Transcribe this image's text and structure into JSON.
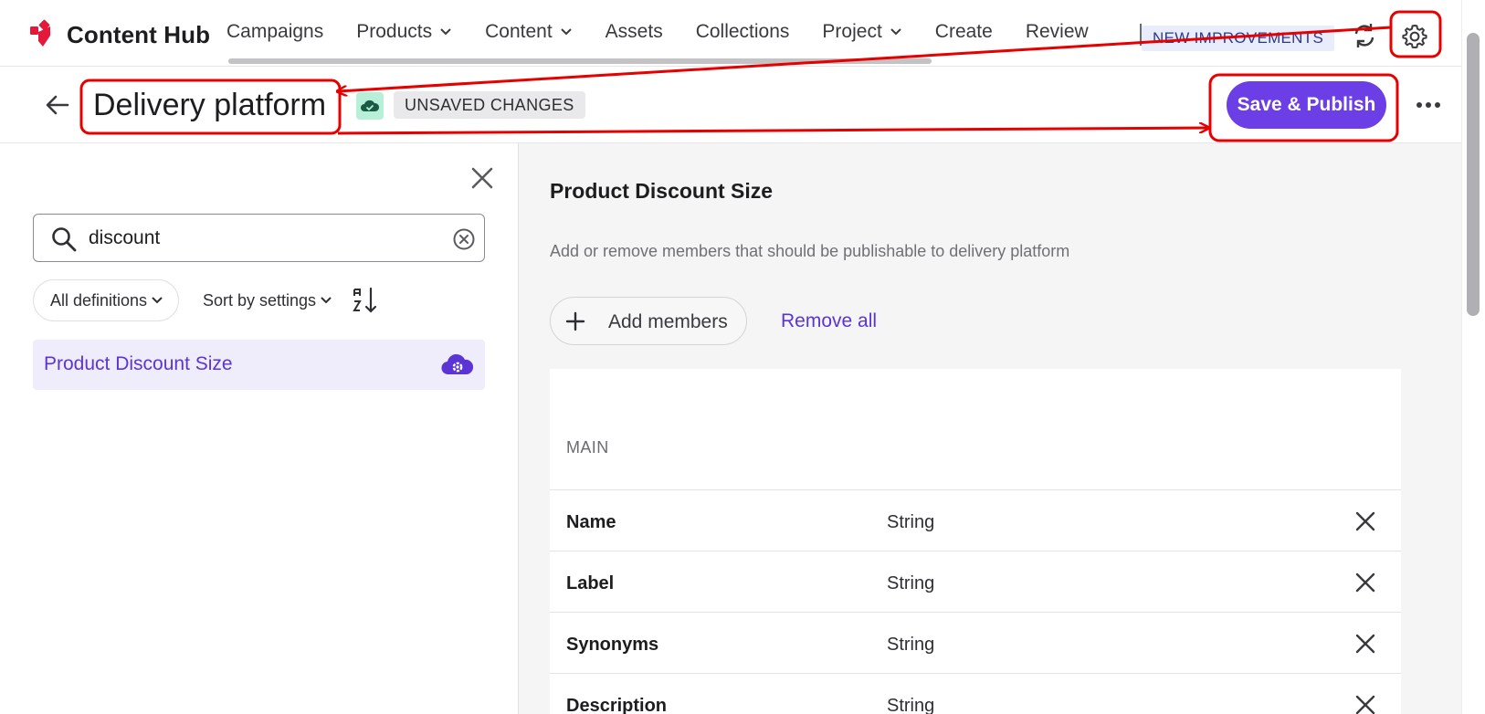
{
  "brand": {
    "name": "Content Hub",
    "logo_icon": "content-hub-logo-icon",
    "color": "#e3183a"
  },
  "nav": {
    "items": [
      {
        "label": "Campaigns",
        "dropdown": false
      },
      {
        "label": "Products",
        "dropdown": true
      },
      {
        "label": "Content",
        "dropdown": true
      },
      {
        "label": "Assets",
        "dropdown": false
      },
      {
        "label": "Collections",
        "dropdown": false
      },
      {
        "label": "Project",
        "dropdown": true
      },
      {
        "label": "Create",
        "dropdown": false
      },
      {
        "label": "Review",
        "dropdown": false
      }
    ],
    "badge": "NEW IMPROVEMENTS"
  },
  "header": {
    "title": "Delivery platform",
    "status_badge": "UNSAVED CHANGES",
    "save_label": "Save & Publish"
  },
  "sidebar": {
    "search_value": "discount",
    "filter_label": "All definitions",
    "sort_label": "Sort by settings",
    "items": [
      {
        "label": "Product Discount Size"
      }
    ]
  },
  "main": {
    "title": "Product Discount Size",
    "description": "Add or remove members that should be publishable to delivery platform",
    "add_label": "Add members",
    "remove_label": "Remove all",
    "group_label": "MAIN",
    "members": [
      {
        "name": "Name",
        "type": "String"
      },
      {
        "name": "Label",
        "type": "String"
      },
      {
        "name": "Synonyms",
        "type": "String"
      },
      {
        "name": "Description",
        "type": "String"
      }
    ]
  },
  "colors": {
    "accent": "#6c3fe6",
    "link": "#5b34d6",
    "annotation": "#e60000",
    "badge_bg": "#e8ecfb",
    "cloud_badge": "#b7efd9"
  }
}
